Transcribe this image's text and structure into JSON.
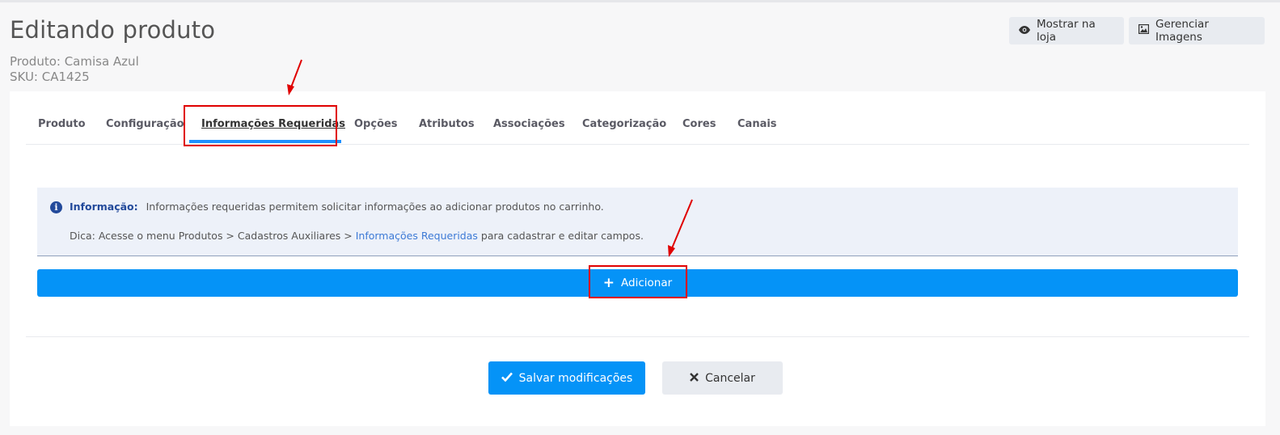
{
  "header": {
    "title": "Editando produto",
    "product": "Produto: Camisa Azul",
    "sku": "SKU: CA1425",
    "show_store_label": "Mostrar na loja",
    "manage_images_label": "Gerenciar Imagens"
  },
  "tabs": [
    {
      "label": "Produto"
    },
    {
      "label": "Configuração"
    },
    {
      "label": "Informações Requeridas",
      "active": true
    },
    {
      "label": "Opções"
    },
    {
      "label": "Atributos"
    },
    {
      "label": "Associações"
    },
    {
      "label": "Categorização"
    },
    {
      "label": "Cores"
    },
    {
      "label": "Canais"
    }
  ],
  "info": {
    "title": "Informação:",
    "text": "Informações requeridas permitem solicitar informações ao adicionar produtos no carrinho.",
    "tip_prefix": "Dica: Acesse o menu Produtos > Cadastros Auxiliares > ",
    "tip_link": "Informações Requeridas",
    "tip_suffix": " para cadastrar e editar campos."
  },
  "add_label": "Adicionar",
  "save_label": "Salvar modificações",
  "cancel_label": "Cancelar",
  "colors": {
    "primary": "#0593f7",
    "highlight": "#e00000"
  }
}
